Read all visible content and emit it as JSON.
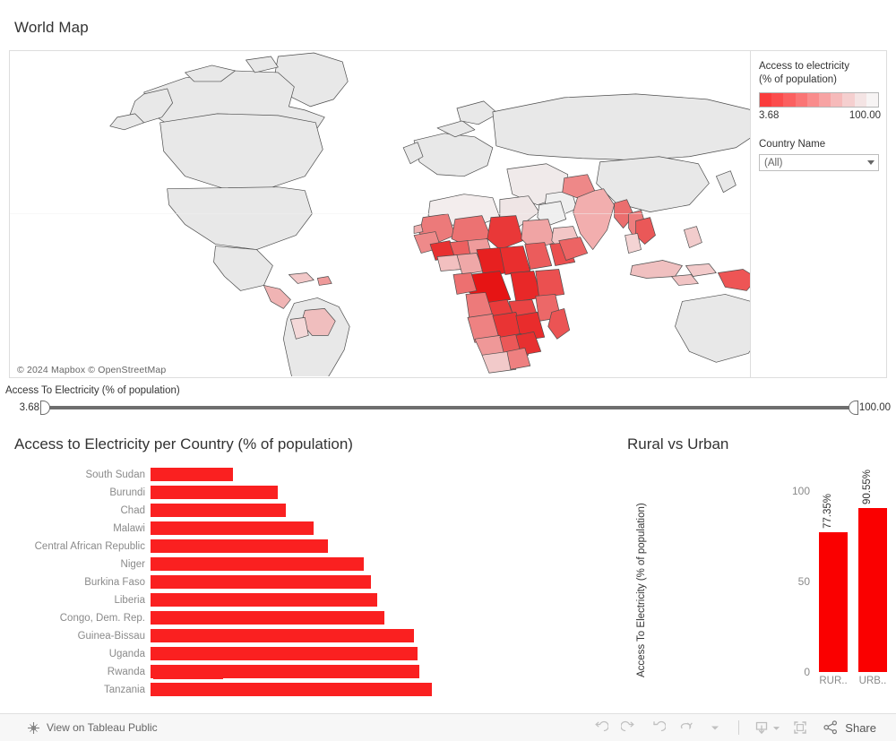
{
  "map": {
    "title": "World Map",
    "attribution": "© 2024 Mapbox  © OpenStreetMap",
    "legend": {
      "title_line1": "Access to electricity",
      "title_line2": "(% of population)",
      "min": "3.68",
      "max": "100.00",
      "ramp_colors": [
        "#FA3C3C",
        "#FB4C4C",
        "#FB6060",
        "#FA7575",
        "#F98C8C",
        "#F7A3A3",
        "#F6BABA",
        "#F5CFCF",
        "#F4E4E4",
        "#F7F4F4"
      ]
    },
    "filter": {
      "label": "Country Name",
      "value": "(All)",
      "icon": "chevron-down-icon"
    },
    "base_land_color": "#E8E8E8",
    "border_color": "#4d4d4d"
  },
  "range_filter": {
    "label": "Access To Electricity (% of population)",
    "min": "3.68",
    "max": "100.00",
    "min_value": 3.68,
    "max_value": 100.0
  },
  "chart_data": [
    {
      "type": "bar",
      "orientation": "horizontal",
      "title": "Access to Electricity per Country (% of population)",
      "xlabel": "",
      "ylabel": "",
      "color": "#FA2020",
      "xlim": [
        0,
        25
      ],
      "categories": [
        "South Sudan",
        "Burundi",
        "Chad",
        "Malawi",
        "Central African Republic",
        "Niger",
        "Burkina Faso",
        "Liberia",
        "Congo, Dem. Rep.",
        "Guinea-Bissau",
        "Uganda",
        "Rwanda",
        "Tanzania"
      ],
      "values": [
        7.2,
        11.1,
        11.8,
        14.2,
        15.5,
        18.6,
        19.2,
        19.8,
        20.4,
        23.0,
        23.3,
        23.4,
        24.5
      ]
    },
    {
      "type": "bar",
      "orientation": "vertical",
      "title": "Rural vs Urban",
      "ylabel": "Access To Electricity (% of population)",
      "xlabel": "",
      "color": "#FA0000",
      "ylim": [
        0,
        110
      ],
      "yticks": [
        "0",
        "50",
        "100"
      ],
      "ytick_values": [
        0,
        50,
        100
      ],
      "categories": [
        "RUR..",
        "URB.."
      ],
      "values": [
        77.35,
        90.55
      ],
      "value_labels": [
        "77.35%",
        "90.55%"
      ]
    }
  ],
  "toolbar": {
    "tableau_link": "View on Tableau Public",
    "tableau_icon": "tableau-logo-icon",
    "buttons": [
      {
        "name": "undo-button",
        "icon": "undo-icon"
      },
      {
        "name": "redo-button",
        "icon": "redo-icon"
      },
      {
        "name": "revert-button",
        "icon": "revert-icon"
      },
      {
        "name": "refresh-button",
        "icon": "refresh-icon"
      },
      {
        "name": "pause-dropdown-button",
        "icon": "chevron-down-icon"
      },
      {
        "name": "download-button",
        "icon": "download-icon"
      },
      {
        "name": "fullscreen-button",
        "icon": "fullscreen-icon"
      }
    ],
    "share_label": "Share",
    "share_icon": "share-icon"
  }
}
